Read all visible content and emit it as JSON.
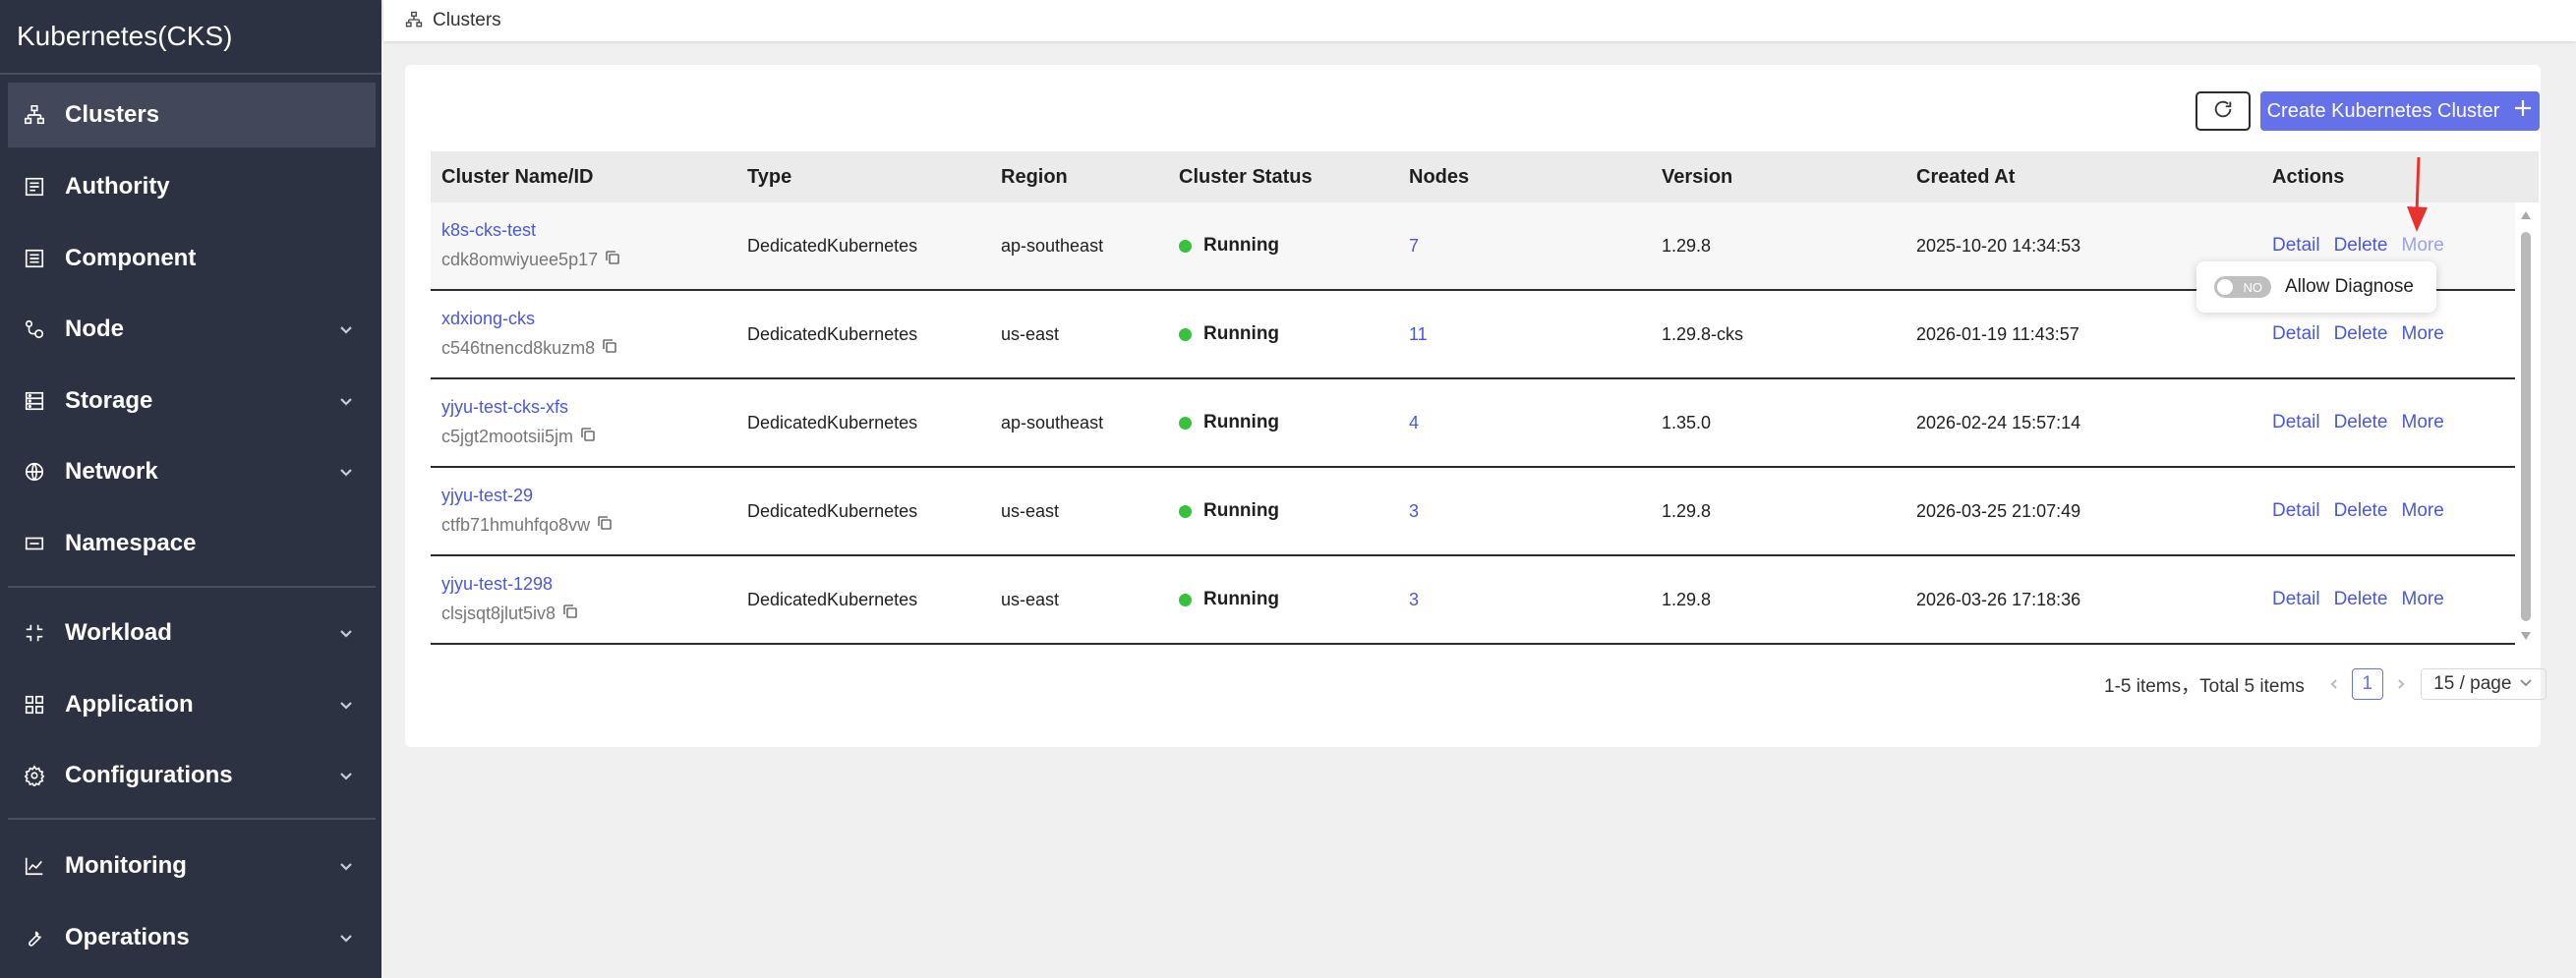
{
  "app": {
    "title": "Kubernetes(CKS)"
  },
  "sidebar": {
    "items": [
      {
        "label": "Clusters",
        "icon": "clusters-icon",
        "active": true,
        "expandable": false
      },
      {
        "label": "Authority",
        "icon": "authority-icon",
        "active": false,
        "expandable": false
      },
      {
        "label": "Component",
        "icon": "component-icon",
        "active": false,
        "expandable": false
      },
      {
        "label": "Node",
        "icon": "node-icon",
        "active": false,
        "expandable": true
      },
      {
        "label": "Storage",
        "icon": "storage-icon",
        "active": false,
        "expandable": true
      },
      {
        "label": "Network",
        "icon": "globe-icon",
        "active": false,
        "expandable": true
      },
      {
        "label": "Namespace",
        "icon": "namespace-icon",
        "active": false,
        "expandable": false
      },
      {
        "label": "Workload",
        "icon": "workload-icon",
        "active": false,
        "expandable": true
      },
      {
        "label": "Application",
        "icon": "application-icon",
        "active": false,
        "expandable": true
      },
      {
        "label": "Configurations",
        "icon": "gear-icon",
        "active": false,
        "expandable": true
      },
      {
        "label": "Monitoring",
        "icon": "chart-line-icon",
        "active": false,
        "expandable": true
      },
      {
        "label": "Operations",
        "icon": "wrench-icon",
        "active": false,
        "expandable": true
      }
    ]
  },
  "breadcrumb": {
    "label": "Clusters",
    "icon": "clusters-icon"
  },
  "toolbar": {
    "refresh_icon": "refresh-icon",
    "create_label": "Create Kubernetes Cluster",
    "accent": "#6571e8"
  },
  "table": {
    "headers": {
      "name": "Cluster Name/ID",
      "type": "Type",
      "region": "Region",
      "status": "Cluster Status",
      "nodes": "Nodes",
      "version": "Version",
      "created": "Created At",
      "actions": "Actions"
    },
    "rows": [
      {
        "name": "k8s-cks-test",
        "id": "cdk8omwiyuee5p17",
        "type": "DedicatedKubernetes",
        "region": "ap-southeast",
        "status": "Running",
        "nodes": "7",
        "version": "1.29.8",
        "created": "2025-10-20 14:34:53"
      },
      {
        "name": "xdxiong-cks",
        "id": "c546tnencd8kuzm8",
        "type": "DedicatedKubernetes",
        "region": "us-east",
        "status": "Running",
        "nodes": "11",
        "version": "1.29.8-cks",
        "created": "2026-01-19 11:43:57"
      },
      {
        "name": "yjyu-test-cks-xfs",
        "id": "c5jgt2mootsii5jm",
        "type": "DedicatedKubernetes",
        "region": "ap-southeast",
        "status": "Running",
        "nodes": "4",
        "version": "1.35.0",
        "created": "2026-02-24 15:57:14"
      },
      {
        "name": "yjyu-test-29",
        "id": "ctfb71hmuhfqo8vw",
        "type": "DedicatedKubernetes",
        "region": "us-east",
        "status": "Running",
        "nodes": "3",
        "version": "1.29.8",
        "created": "2026-03-25 21:07:49"
      },
      {
        "name": "yjyu-test-1298",
        "id": "clsjsqt8jlut5iv8",
        "type": "DedicatedKubernetes",
        "region": "us-east",
        "status": "Running",
        "nodes": "3",
        "version": "1.29.8",
        "created": "2026-03-26 17:18:36"
      }
    ],
    "actions": {
      "detail": "Detail",
      "delete": "Delete",
      "more": "More"
    },
    "status_color": "#36c23a"
  },
  "popover": {
    "toggle_label": "NO",
    "label": "Allow Diagnose"
  },
  "pagination": {
    "summary": "1-5 items，Total 5 items",
    "current_page": "1",
    "page_size": "15 / page"
  }
}
